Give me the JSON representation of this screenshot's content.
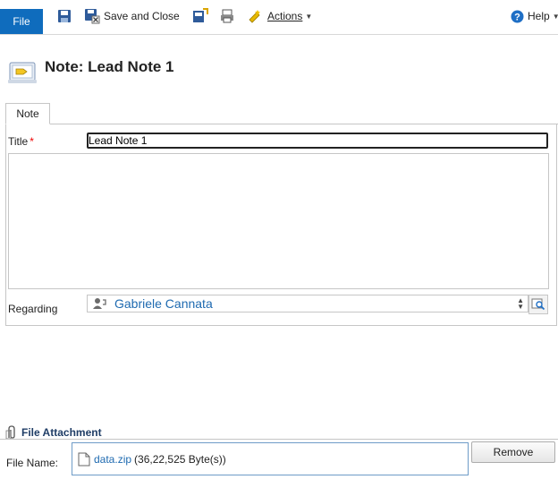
{
  "toolbar": {
    "file_label": "File",
    "save_close_label": "Save and Close",
    "actions_label": "Actions",
    "help_label": "Help"
  },
  "header": {
    "title": "Note: Lead Note 1"
  },
  "tabs": [
    {
      "label": "Note"
    }
  ],
  "form": {
    "title_label": "Title",
    "required_mark": "*",
    "title_value": "Lead Note 1",
    "regarding_label": "Regarding",
    "regarding_value": "Gabriele Cannata"
  },
  "attachment": {
    "section_title": "File Attachment",
    "file_name_label": "File Name:",
    "file_name": "data.zip",
    "file_size": "(36,22,525 Byte(s))",
    "remove_label": "Remove"
  },
  "icons": [
    "file-tab",
    "save-icon",
    "save-close-icon",
    "attach-icon",
    "print-icon",
    "actions-icon",
    "help-icon",
    "note-icon",
    "contact-icon",
    "lookup-icon",
    "paperclip-icon",
    "document-icon"
  ],
  "colors": {
    "accent": "#0f6cbd",
    "link": "#1e6ab0",
    "required": "#e00000",
    "section_title": "#1f3d66"
  }
}
